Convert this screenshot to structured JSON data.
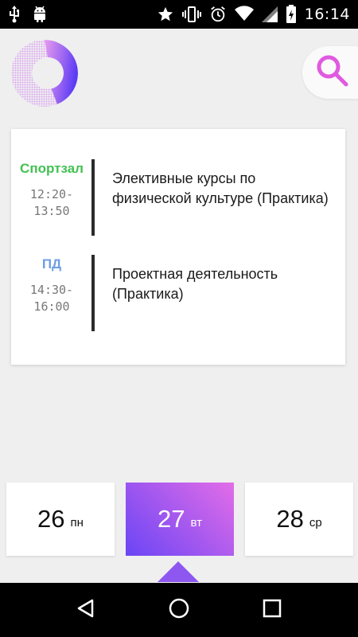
{
  "status_bar": {
    "time": "16:14",
    "icons": [
      "usb-icon",
      "android-icon",
      "star-icon",
      "vibrate-icon",
      "alarm-icon",
      "wifi-icon",
      "signal-icon",
      "battery-charging-icon"
    ]
  },
  "header": {
    "logo_icon": "ring-logo-icon",
    "search_icon": "search-icon"
  },
  "schedule": {
    "lessons": [
      {
        "room": "Спортзал",
        "room_color": "#43c152",
        "start": "12:20-",
        "end": "13:50",
        "subject": "Элективные курсы по физической культуре (Практика)"
      },
      {
        "room": "ПД",
        "room_color": "#6f9ee4",
        "start": "14:30-",
        "end": "16:00",
        "subject": "Проектная деятельность (Практика)"
      }
    ]
  },
  "dates": [
    {
      "num": "26",
      "day": "пн",
      "selected": false
    },
    {
      "num": "27",
      "day": "вт",
      "selected": true
    },
    {
      "num": "28",
      "day": "ср",
      "selected": false
    }
  ],
  "colors": {
    "accent_start": "#6a45f5",
    "accent_end": "#e36de8",
    "search_icon": "#e05ae0"
  },
  "nav_bar": {
    "icons": [
      "back-icon",
      "home-icon",
      "recents-icon"
    ]
  }
}
